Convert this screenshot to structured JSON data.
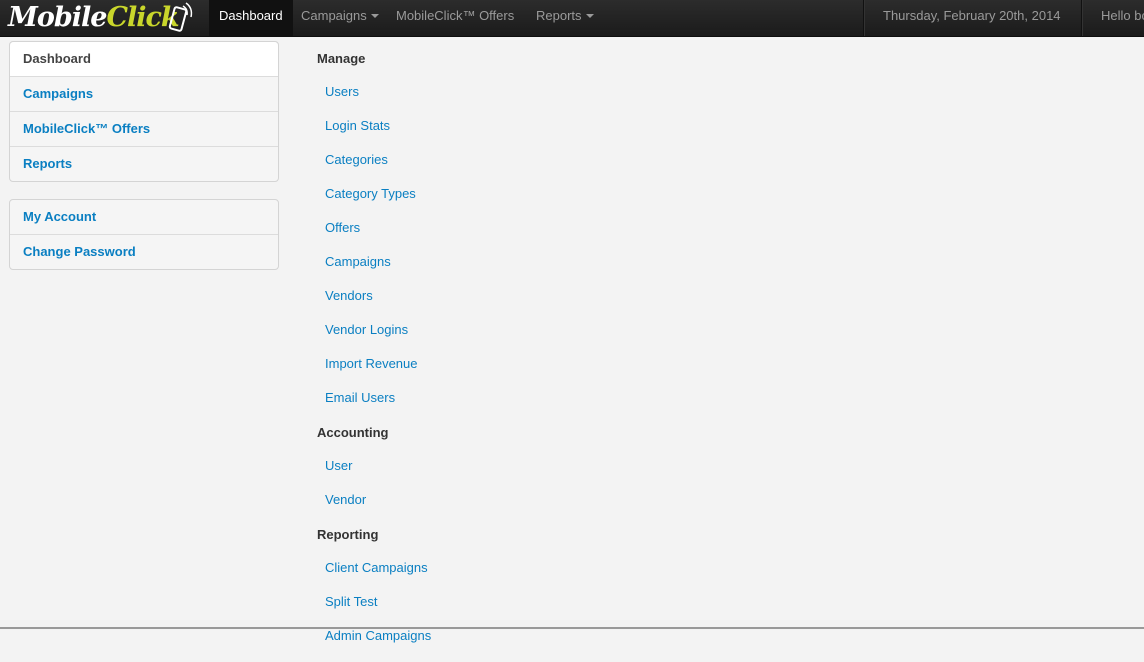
{
  "navbar": {
    "brand": {
      "part1": "Mobile",
      "part2": "Click"
    },
    "items": [
      {
        "label": "Dashboard",
        "active": true,
        "caret": false
      },
      {
        "label": "Campaigns",
        "active": false,
        "caret": true
      },
      {
        "label": "MobileClick™ Offers",
        "active": false,
        "caret": false
      },
      {
        "label": "Reports",
        "active": false,
        "caret": true
      }
    ],
    "date": "Thursday, February 20th, 2014",
    "greeting": "Hello bo"
  },
  "sidebar": {
    "main_items": [
      {
        "label": "Dashboard",
        "active": true
      },
      {
        "label": "Campaigns"
      },
      {
        "label": "MobileClick™ Offers"
      },
      {
        "label": "Reports"
      }
    ],
    "account_items": [
      {
        "label": "My Account"
      },
      {
        "label": "Change Password"
      }
    ]
  },
  "main": {
    "sections": [
      {
        "heading": "Manage",
        "links": [
          "Users",
          "Login Stats",
          "Categories",
          "Category Types",
          "Offers",
          "Campaigns",
          "Vendors",
          "Vendor Logins",
          "Import Revenue",
          "Email Users"
        ]
      },
      {
        "heading": "Accounting",
        "links": [
          "User",
          "Vendor"
        ]
      },
      {
        "heading": "Reporting",
        "links": [
          "Client Campaigns",
          "Split Test",
          "Admin Campaigns"
        ]
      }
    ]
  },
  "colors": {
    "link": "#0a7fc2",
    "navbar": "#1b1b1b",
    "brand_accent": "#c9d62b"
  }
}
